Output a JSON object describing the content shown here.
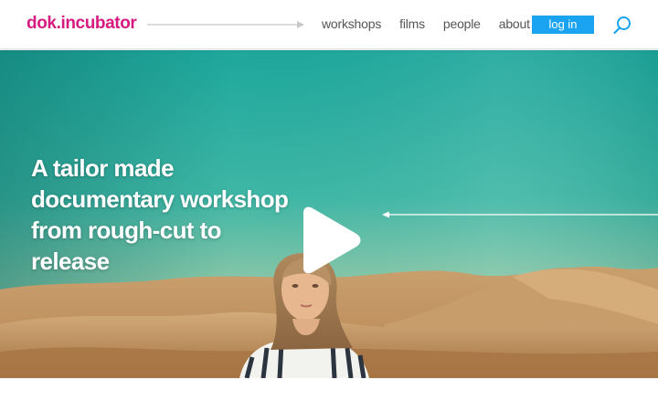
{
  "header": {
    "logo_text": "dok.incubator",
    "nav": [
      {
        "label": "workshops"
      },
      {
        "label": "films"
      },
      {
        "label": "people"
      },
      {
        "label": "about"
      }
    ],
    "login_label": "log in",
    "search_icon": "search-icon"
  },
  "hero": {
    "title": "A tailor made documentary workshop from rough-cut to release",
    "play_icon": "play-icon"
  },
  "colors": {
    "brand": "#d61a7f",
    "accent": "#1aa3f0",
    "nav_text": "#555555",
    "hero_sky": "#27b5a4",
    "hero_sand": "#c9a06a"
  }
}
